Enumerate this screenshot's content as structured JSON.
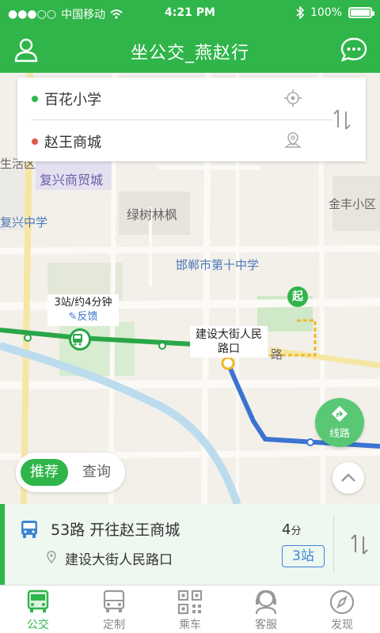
{
  "status_bar": {
    "carrier": "中国移动",
    "time": "4:21 PM",
    "battery": "100%"
  },
  "header": {
    "title": "坐公交_燕赵行",
    "user_icon": "user-icon",
    "message_icon": "chat-bubble-icon"
  },
  "route": {
    "origin": "百花小学",
    "destination": "赵王商城",
    "origin_dot_color": "#2fb54a",
    "destination_dot_color": "#e0584a"
  },
  "map": {
    "labels": {
      "area_left": "生活区",
      "fuxing_trade": "复兴商贸城",
      "fuxing_school": "复兴中学",
      "lvshu": "绿树林枫",
      "jinfeng": "金丰小区",
      "school10": "邯郸市第十中学",
      "road": "路",
      "start_marker": "起"
    },
    "info_bubble": {
      "stops_time": "3站/约4分钟",
      "feedback": "反馈"
    },
    "stop_bubble": "建设大街人民路口"
  },
  "toggle": {
    "active": "推荐",
    "inactive": "查询"
  },
  "route_fab": "线路",
  "bus": {
    "line": "53路 开往赵王商城",
    "stop": "建设大街人民路口",
    "minutes_value": "4",
    "minutes_unit": "分",
    "stops": "3站"
  },
  "tabs": [
    {
      "label": "公交",
      "icon": "bus-icon"
    },
    {
      "label": "定制",
      "icon": "coach-icon"
    },
    {
      "label": "乘车",
      "icon": "qr-code-icon"
    },
    {
      "label": "客服",
      "icon": "headset-icon"
    },
    {
      "label": "发现",
      "icon": "compass-icon"
    }
  ],
  "colors": {
    "brand": "#2fb54a",
    "route_blue": "#3b74d0",
    "walk_yellow": "#f0b92b"
  }
}
